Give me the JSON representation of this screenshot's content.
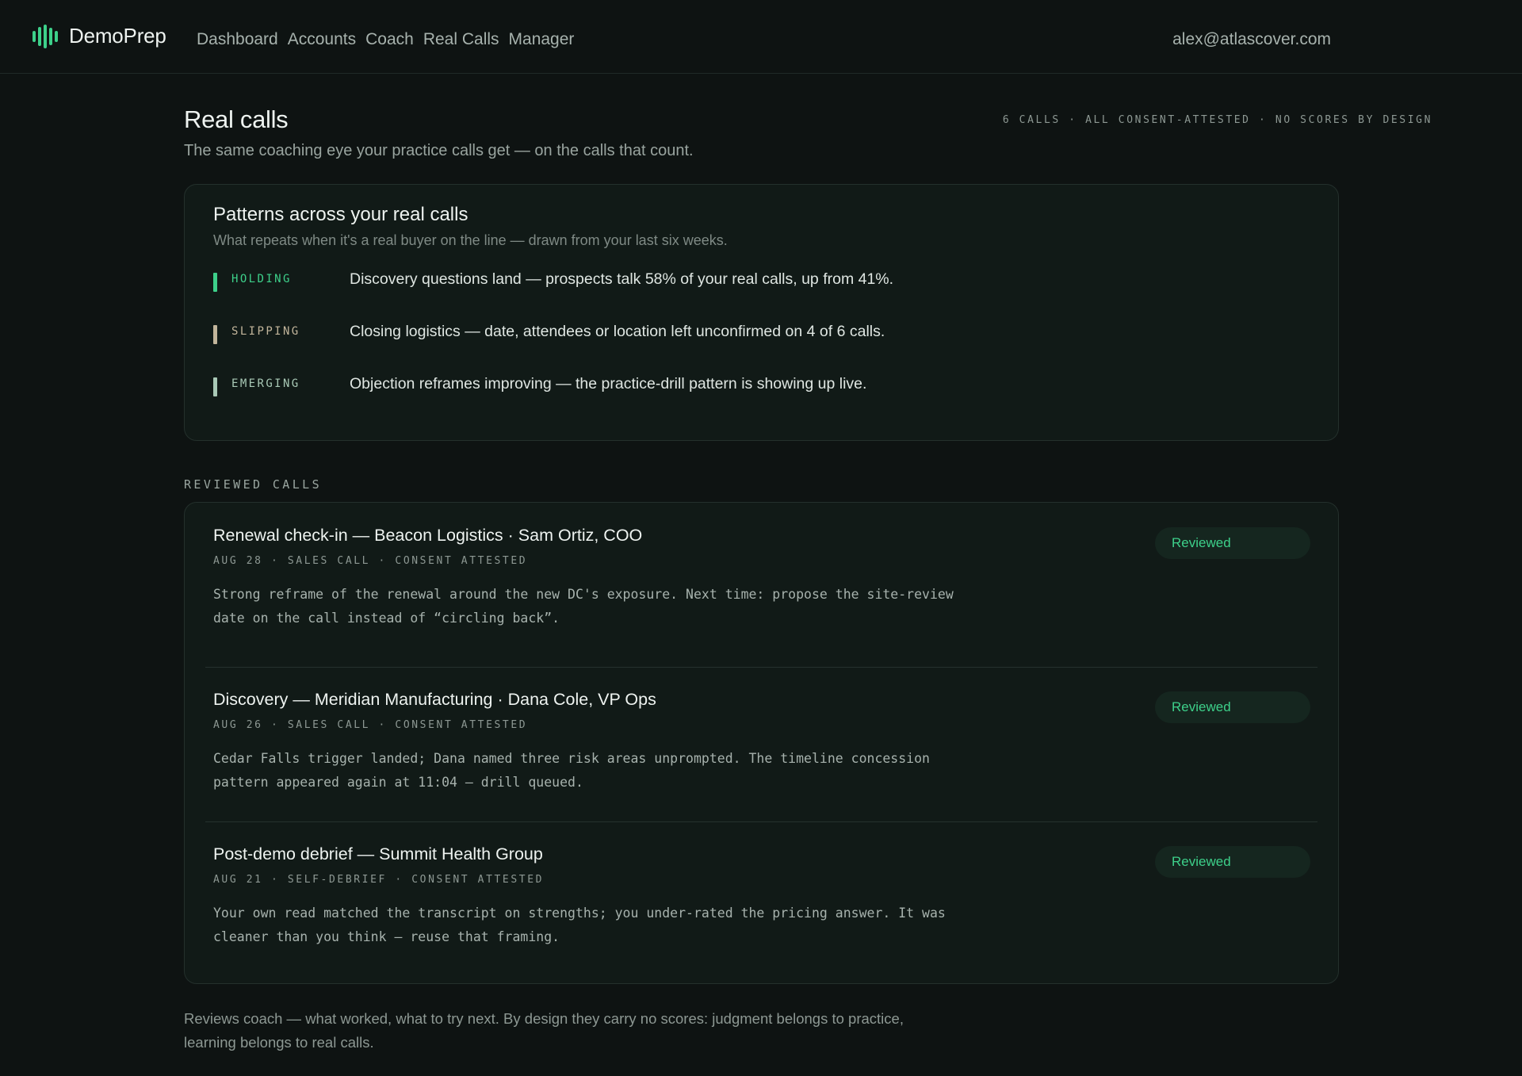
{
  "brand": {
    "name": "DemoPrep",
    "accent": "#3dd08a"
  },
  "nav": {
    "items": [
      {
        "label": "Dashboard"
      },
      {
        "label": "Accounts"
      },
      {
        "label": "Coach"
      },
      {
        "label": "Real Calls"
      },
      {
        "label": "Manager"
      }
    ]
  },
  "user": {
    "email": "alex@atlascover.com"
  },
  "page": {
    "title": "Real calls",
    "subtitle": "The same coaching eye your practice calls get — on the calls that count.",
    "meta": "6 CALLS · ALL CONSENT-ATTESTED · NO SCORES BY DESIGN"
  },
  "patterns": {
    "title": "Patterns across your real calls",
    "subtitle": "What repeats when it's a real buyer on the line — drawn from your last six weeks.",
    "items": [
      {
        "tag": "HOLDING",
        "color": "#3dd08a",
        "text": "Discovery questions land — prospects talk 58% of your real calls, up from 41%."
      },
      {
        "tag": "SLIPPING",
        "color": "#c2b59b",
        "text": "Closing logistics — date, attendees or location left unconfirmed on 4 of 6 calls."
      },
      {
        "tag": "EMERGING",
        "color": "#a9c9b6",
        "text": "Objection reframes improving — the practice-drill pattern is showing up live."
      }
    ]
  },
  "reviewed": {
    "label": "REVIEWED CALLS",
    "calls": [
      {
        "title": "Renewal check-in — Beacon Logistics · Sam Ortiz, COO",
        "meta": "AUG 28 · SALES CALL · CONSENT ATTESTED",
        "note": "Strong reframe of the renewal around the new DC's exposure. Next time: propose the site-review date on the call instead of “circling back”.",
        "status": "Reviewed"
      },
      {
        "title": "Discovery — Meridian Manufacturing · Dana Cole, VP Ops",
        "meta": "AUG 26 · SALES CALL · CONSENT ATTESTED",
        "note": "Cedar Falls trigger landed; Dana named three risk areas unprompted. The timeline concession pattern appeared again at 11:04 — drill queued.",
        "status": "Reviewed"
      },
      {
        "title": "Post-demo debrief — Summit Health Group",
        "meta": "AUG 21 · SELF-DEBRIEF · CONSENT ATTESTED",
        "note": "Your own read matched the transcript on strengths; you under-rated the pricing answer. It was cleaner than you think — reuse that framing.",
        "status": "Reviewed"
      }
    ]
  },
  "footnote": "Reviews coach — what worked, what to try next. By design they carry no scores: judgment belongs to practice, learning belongs to real calls."
}
